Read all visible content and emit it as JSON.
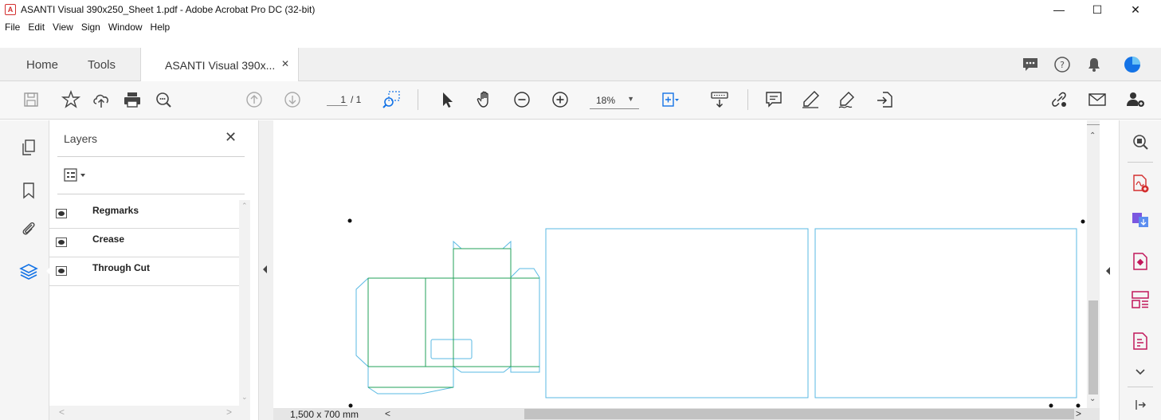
{
  "window": {
    "app_icon_glyph": "A",
    "title": "ASANTI Visual 390x250_Sheet 1.pdf - Adobe Acrobat Pro DC (32-bit)",
    "minimize_glyph": "—",
    "maximize_glyph": "☐",
    "close_glyph": "✕"
  },
  "menu": [
    "File",
    "Edit",
    "View",
    "Sign",
    "Window",
    "Help"
  ],
  "tabs": {
    "home": "Home",
    "tools": "Tools",
    "document": "ASANTI Visual 390x...",
    "document_close": "✕"
  },
  "toolbar": {
    "page_current": "1",
    "page_total": "/ 1",
    "zoom": "18%",
    "zoom_caret": "▼"
  },
  "layers_panel": {
    "title": "Layers",
    "close_glyph": "✕",
    "layers": [
      {
        "name": "Regmarks"
      },
      {
        "name": "Crease"
      },
      {
        "name": "Through Cut"
      }
    ]
  },
  "scroll": {
    "up": "⌃",
    "down": "⌄",
    "left": "<",
    "right": ">"
  },
  "status": {
    "page_size": "1,500 x 700 mm"
  },
  "colors": {
    "cut_line": "#5ab9e3",
    "crease_line": "#22a05a",
    "acrobat_red": "#d32f2f",
    "accent_blue": "#1473e6"
  },
  "icons": {
    "left_rail": [
      "page-thumbnails-icon",
      "bookmark-icon",
      "attachment-icon",
      "layers-icon"
    ],
    "right_rail": [
      "enhance-scans-icon",
      "create-pdf-icon",
      "export-pdf-icon",
      "edit-pdf-icon",
      "organize-pages-icon",
      "fill-sign-icon"
    ]
  }
}
